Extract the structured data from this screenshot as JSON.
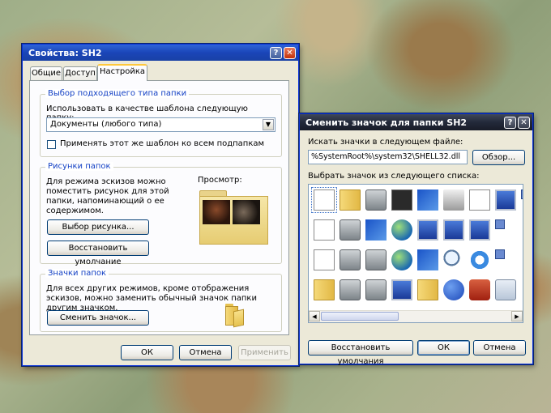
{
  "props": {
    "title": "Свойства: SH2",
    "tabs": [
      "Общие",
      "Доступ",
      "Настройка"
    ],
    "folder_type": {
      "group": "Выбор подходящего типа папки",
      "label": "Использовать в качестве шаблона следующую папку:",
      "value": "Документы (любого типа)",
      "apply_all": "Применять этот же шаблон ко всем подпапкам"
    },
    "pictures": {
      "group": "Рисунки папок",
      "desc": "Для режима эскизов можно поместить рисунок для этой папки, напоминающий о ее содержимом.",
      "preview": "Просмотр:",
      "choose": "Выбор рисунка...",
      "restore": "Восстановить умолчание"
    },
    "icons": {
      "group": "Значки папок",
      "desc": "Для всех других режимов, кроме отображения эскизов, можно заменить обычный значок папки другим значком.",
      "change": "Сменить значок..."
    },
    "ok": "ОК",
    "cancel": "Отмена",
    "apply": "Применить"
  },
  "change_icon": {
    "title": "Сменить значок для папки SH2",
    "search_label": "Искать значки в следующем файле:",
    "file_value": "%SystemRoot%\\system32\\SHELL32.dll",
    "browse": "Обзор...",
    "list_label": "Выбрать значок из следующего списка:",
    "restore": "Восстановить умолчания",
    "ok": "ОК",
    "cancel": "Отмена",
    "icons": [
      [
        "default-document-icon",
        "folder-icon",
        "drive-icon",
        "memory-chip-icon",
        "network-icon",
        "printer-icon",
        "clock-document-icon",
        "screen-icon",
        "small-app-icon"
      ],
      [
        "text-document-icon",
        "drive-dark-icon",
        "network-drive-icon",
        "globe-network-icon",
        "network-computers-icon",
        "remote-computer-icon",
        "monitor-icon",
        "shortcut-small-icon"
      ],
      [
        "properties-icon",
        "media-drive-icon",
        "disconnected-drive-icon",
        "globe-icon",
        "tiles-icon",
        "search-icon",
        "refresh-icon",
        "clock-small-icon"
      ],
      [
        "folder-yellow-icon",
        "drive-grey-icon",
        "drive-green-icon",
        "computer-network-icon",
        "folder-plain-icon",
        "help-icon",
        "shutdown-icon",
        "recycle-bin-icon"
      ]
    ]
  }
}
